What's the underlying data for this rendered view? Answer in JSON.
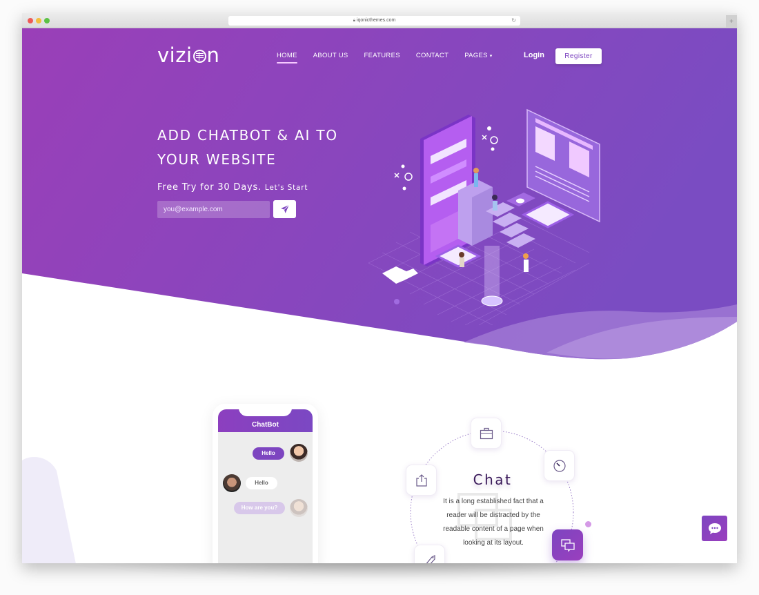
{
  "browser": {
    "url": "iqonicthemes.com",
    "new_tab_label": "+"
  },
  "header": {
    "logo_text_left": "vizi",
    "logo_text_right": "n",
    "nav": [
      {
        "label": "HOME",
        "active": true
      },
      {
        "label": "ABOUT US",
        "active": false
      },
      {
        "label": "FEATURES",
        "active": false
      },
      {
        "label": "CONTACT",
        "active": false
      },
      {
        "label": "PAGES",
        "active": false,
        "has_dropdown": true
      }
    ],
    "dropdown_caret": "▾",
    "login_label": "Login",
    "register_label": "Register"
  },
  "hero": {
    "headline": "ADD CHATBOT & AI TO YOUR WEBSITE",
    "subline_main": "Free Try for 30 Days.",
    "subline_small": "Let's Start",
    "email_placeholder": "you@example.com",
    "email_value": "",
    "send_icon": "paper-plane-icon"
  },
  "chatbot_mock": {
    "title": "ChatBot",
    "messages": [
      {
        "text": "Hello",
        "side": "right",
        "style": "primary"
      },
      {
        "text": "Hello",
        "side": "left",
        "style": "white"
      },
      {
        "text": "How are you?",
        "side": "right",
        "style": "faded"
      }
    ]
  },
  "feature": {
    "title": "Chat",
    "description": "It is a long established fact that a reader will be distracted by the readable content of a page when looking at its layout.",
    "orbit_icons": [
      "briefcase-icon",
      "timer-icon",
      "share-icon",
      "tag-icon",
      "chat-bubbles-icon"
    ],
    "active_icon": "chat-bubbles-icon"
  },
  "floating_chat": {
    "icon": "chat-dots-icon"
  },
  "colors": {
    "brand_purple": "#7d45c0",
    "hero_gradient_start": "#9a3fb8",
    "hero_gradient_end": "#7a4cc2",
    "wave_light": "#a47ed6",
    "heading_dark": "#3a1a5a"
  }
}
